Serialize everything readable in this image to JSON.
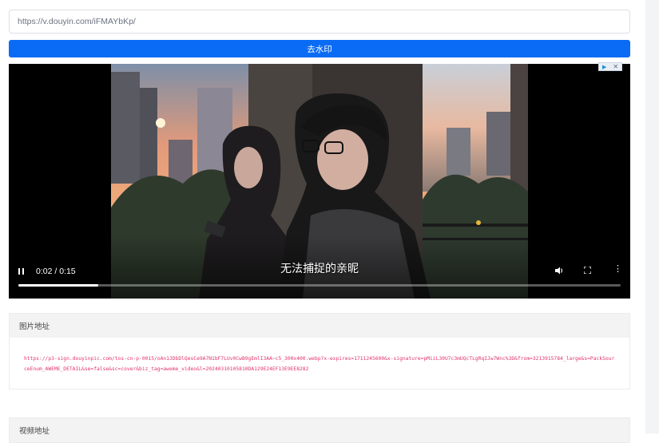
{
  "search": {
    "value": "https://v.douyin.com/iFMAYbKp/"
  },
  "actions": {
    "remove_watermark_label": "去水印"
  },
  "video": {
    "subtitle": "无法捕捉的亲昵",
    "current_time": "0:02",
    "duration": "0:15",
    "time_display": "0:02 / 0:15",
    "progress": 0.133
  },
  "ad": {
    "play_glyph": "▶",
    "close_glyph": "✕"
  },
  "image_section": {
    "title": "图片地址",
    "url": "https://p3-sign.douyinpic.com/tos-cn-p-0015/oAn1JDbDlQesCe9A7N1bF7LUv0CwB9gEmlI3AA~c5_300x400.webp?x-expires=1711245600&x-signature=pMiiL30U7c3mUQcTLgRqIJw7Wnc%3D&from=3213915784_large&s=PackSourceEnum_AWEME_DETAIL&se=false&sc=cover&biz_tag=aweme_video&l=20240310105810DA129E24EF13E9EE8282"
  },
  "video_section": {
    "title": "视频地址"
  },
  "icons": {
    "pause": "pause-icon",
    "volume": "volume-icon",
    "fullscreen": "fullscreen-icon",
    "more": "more-vertical-icon"
  },
  "colors": {
    "accent": "#0a6cf5",
    "url_text": "#e3336a",
    "card_header_bg": "#f3f3f3"
  }
}
